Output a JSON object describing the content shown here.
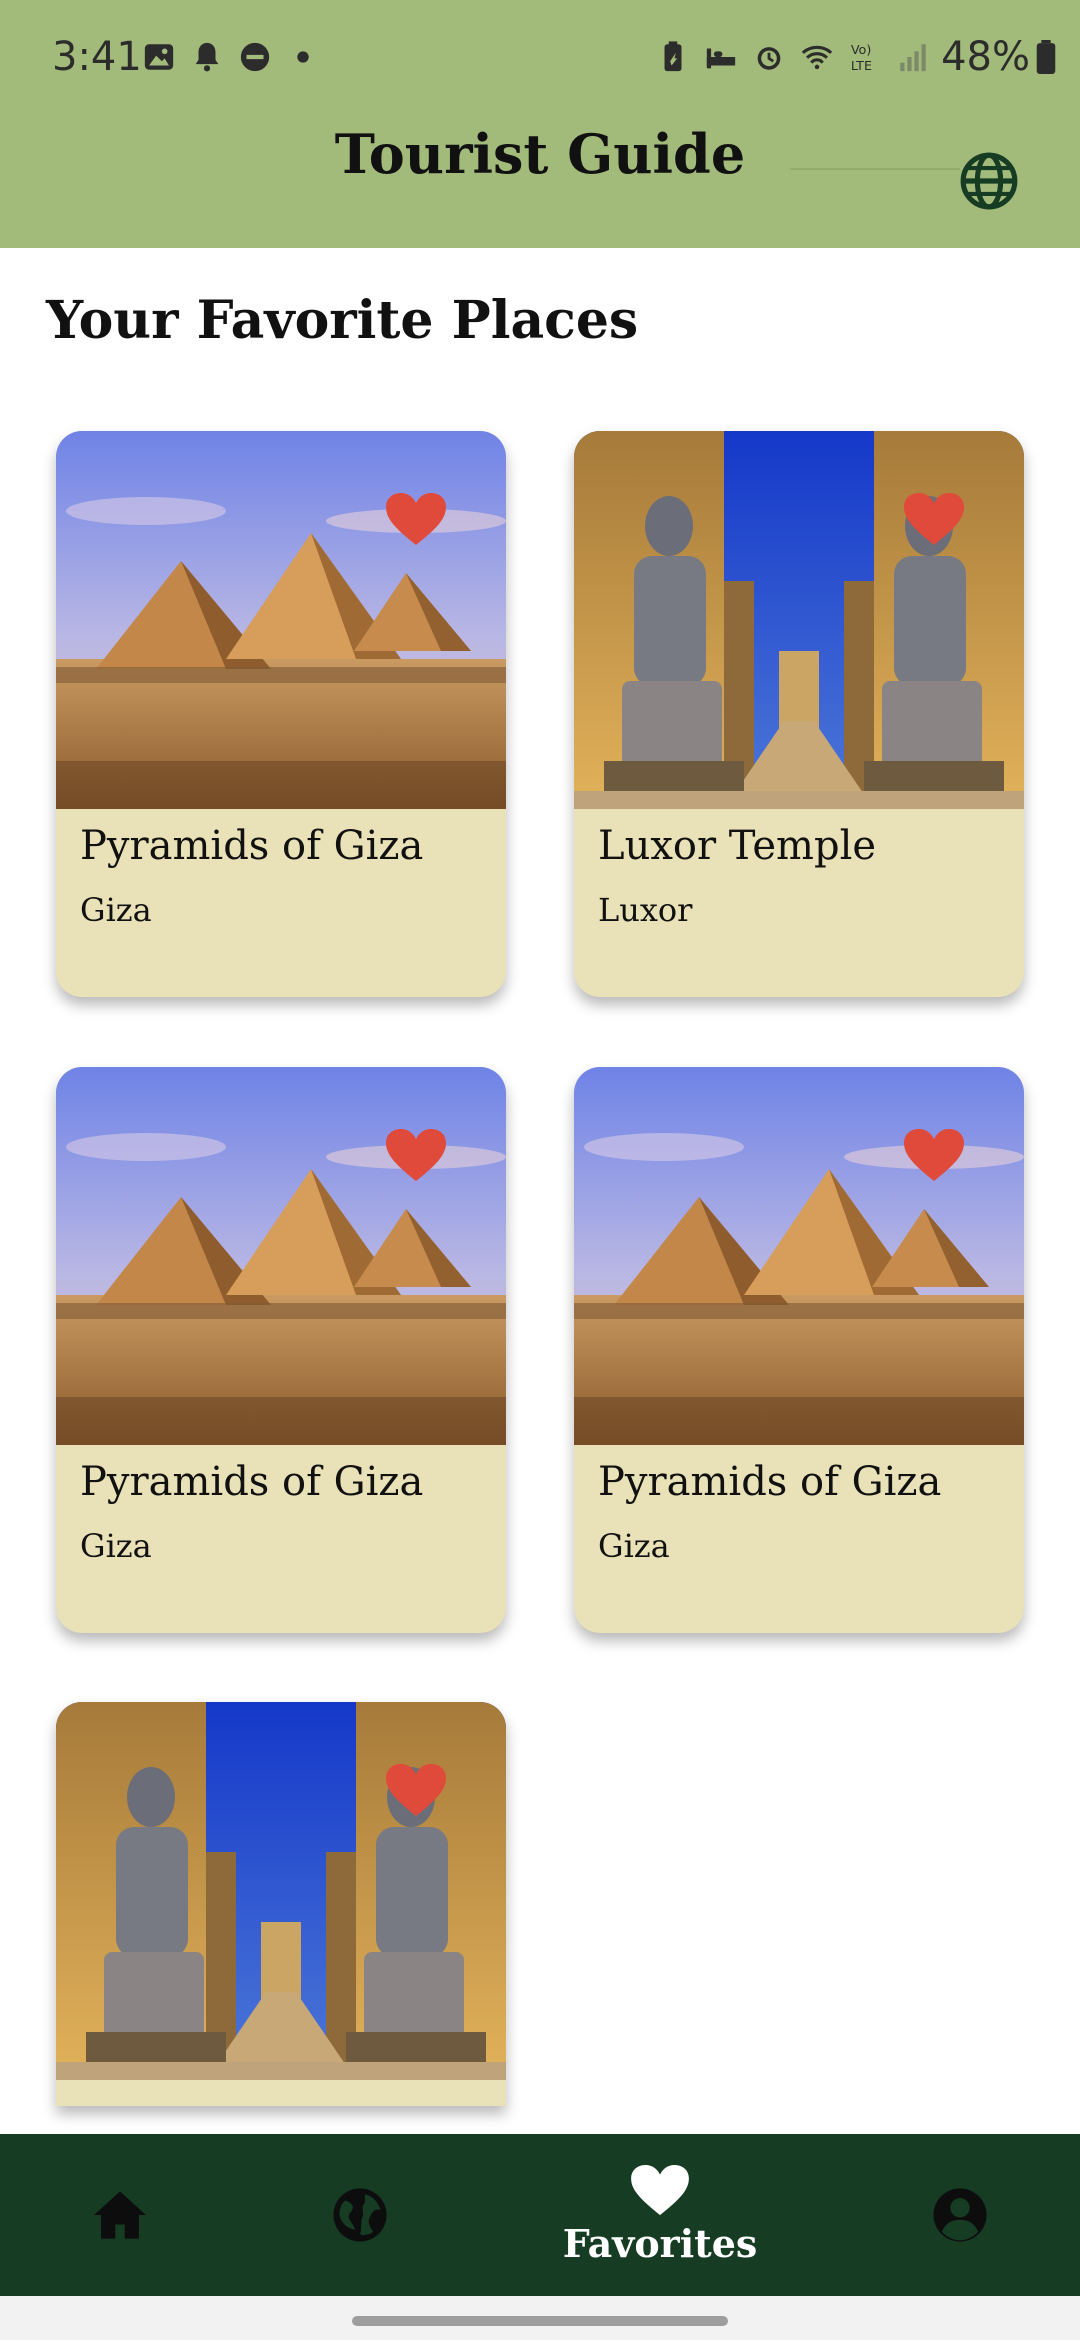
{
  "status_bar": {
    "time": "3:41",
    "battery": "48%",
    "left_icons": [
      "image-icon",
      "bell-icon",
      "dnd-icon",
      "dot-icon"
    ],
    "right_icons": [
      "battery-saver-icon",
      "bed-icon",
      "alarm-icon",
      "wifi-icon",
      "volte-icon",
      "signal-icon"
    ]
  },
  "app_bar": {
    "title": "Tourist Guide",
    "action_icon": "globe-icon"
  },
  "page": {
    "section_title": "Your Favorite Places"
  },
  "favorites": [
    {
      "name": "Pyramids of Giza",
      "city": "Giza",
      "image": "pyramids",
      "favorited": true
    },
    {
      "name": "Luxor Temple",
      "city": "Luxor",
      "image": "luxor",
      "favorited": true
    },
    {
      "name": "Pyramids of Giza",
      "city": "Giza",
      "image": "pyramids",
      "favorited": true
    },
    {
      "name": "Pyramids of Giza",
      "city": "Giza",
      "image": "pyramids",
      "favorited": true
    },
    {
      "name": "",
      "city": "",
      "image": "luxor",
      "favorited": true
    }
  ],
  "bottom_nav": {
    "items": [
      {
        "icon": "home-icon",
        "label": ""
      },
      {
        "icon": "globe-icon",
        "label": ""
      },
      {
        "icon": "heart-icon",
        "label": "Favorites",
        "active": true
      },
      {
        "icon": "account-icon",
        "label": ""
      }
    ]
  },
  "colors": {
    "app_bar": "#a3bb7a",
    "card_bg": "#e9e1b7",
    "heart": "#e04a3a",
    "bottom_nav": "#163c23"
  }
}
